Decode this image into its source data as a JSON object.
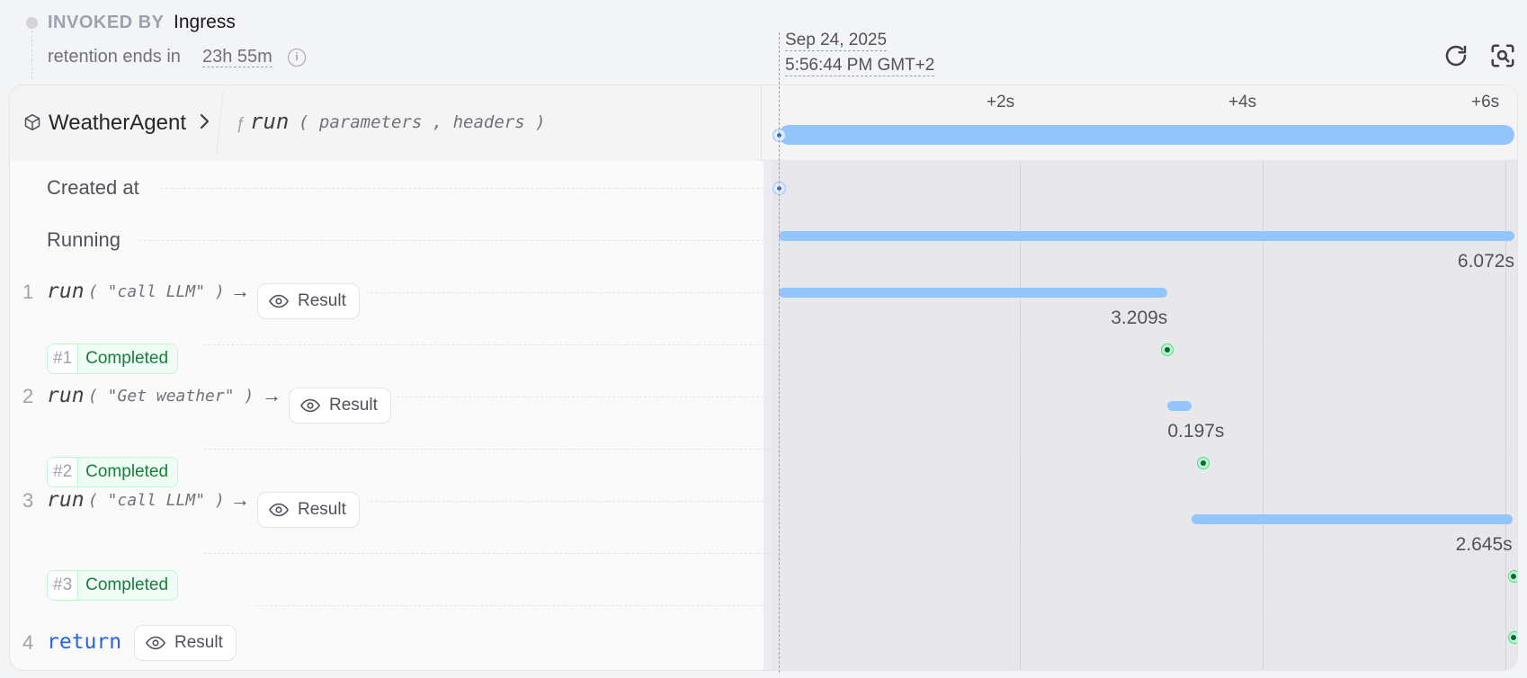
{
  "invocation": {
    "invoked_by_label": "INVOKED BY",
    "invoked_by_value": "Ingress",
    "retention_label": "retention ends in",
    "retention_value": "23h 55m",
    "info_glyph": "i"
  },
  "timestamp": {
    "date": "Sep 24, 2025",
    "time": "5:56:44 PM GMT+2"
  },
  "toolbar": {
    "icons": [
      "refresh-icon",
      "zoom-search-icon"
    ]
  },
  "header": {
    "service": "WeatherAgent",
    "handler_prefix": "ƒ",
    "handler": "run",
    "params": "( parameters , headers )"
  },
  "timeline": {
    "ticks": [
      "+2s",
      "+4s",
      "+6s"
    ],
    "total_seconds": 6.072
  },
  "rows": {
    "created_label": "Created at",
    "running_label": "Running",
    "running_duration": "6.072s"
  },
  "steps": [
    {
      "index": "1",
      "fn": "run",
      "args": "( \"call LLM\" )",
      "result_label": "Result",
      "duration": "3.209s",
      "start": 0,
      "dur": 3.209
    },
    {
      "index": "2",
      "fn": "run",
      "args": "( \"Get weather\" )",
      "result_label": "Result",
      "duration": "0.197s",
      "start": 3.21,
      "dur": 0.197
    },
    {
      "index": "3",
      "fn": "run",
      "args": "( \"call LLM\" )",
      "result_label": "Result",
      "duration": "2.645s",
      "start": 3.41,
      "dur": 2.645
    }
  ],
  "attempts": [
    {
      "num": "#1",
      "status": "Completed"
    },
    {
      "num": "#2",
      "status": "Completed"
    },
    {
      "num": "#3",
      "status": "Completed"
    }
  ],
  "return_step": {
    "index": "4",
    "keyword": "return",
    "result_label": "Result"
  },
  "colors": {
    "bar": "#93c5fd",
    "completed": "#15803d",
    "accent": "#2563eb"
  },
  "glyphs": {
    "arrow": "→"
  }
}
